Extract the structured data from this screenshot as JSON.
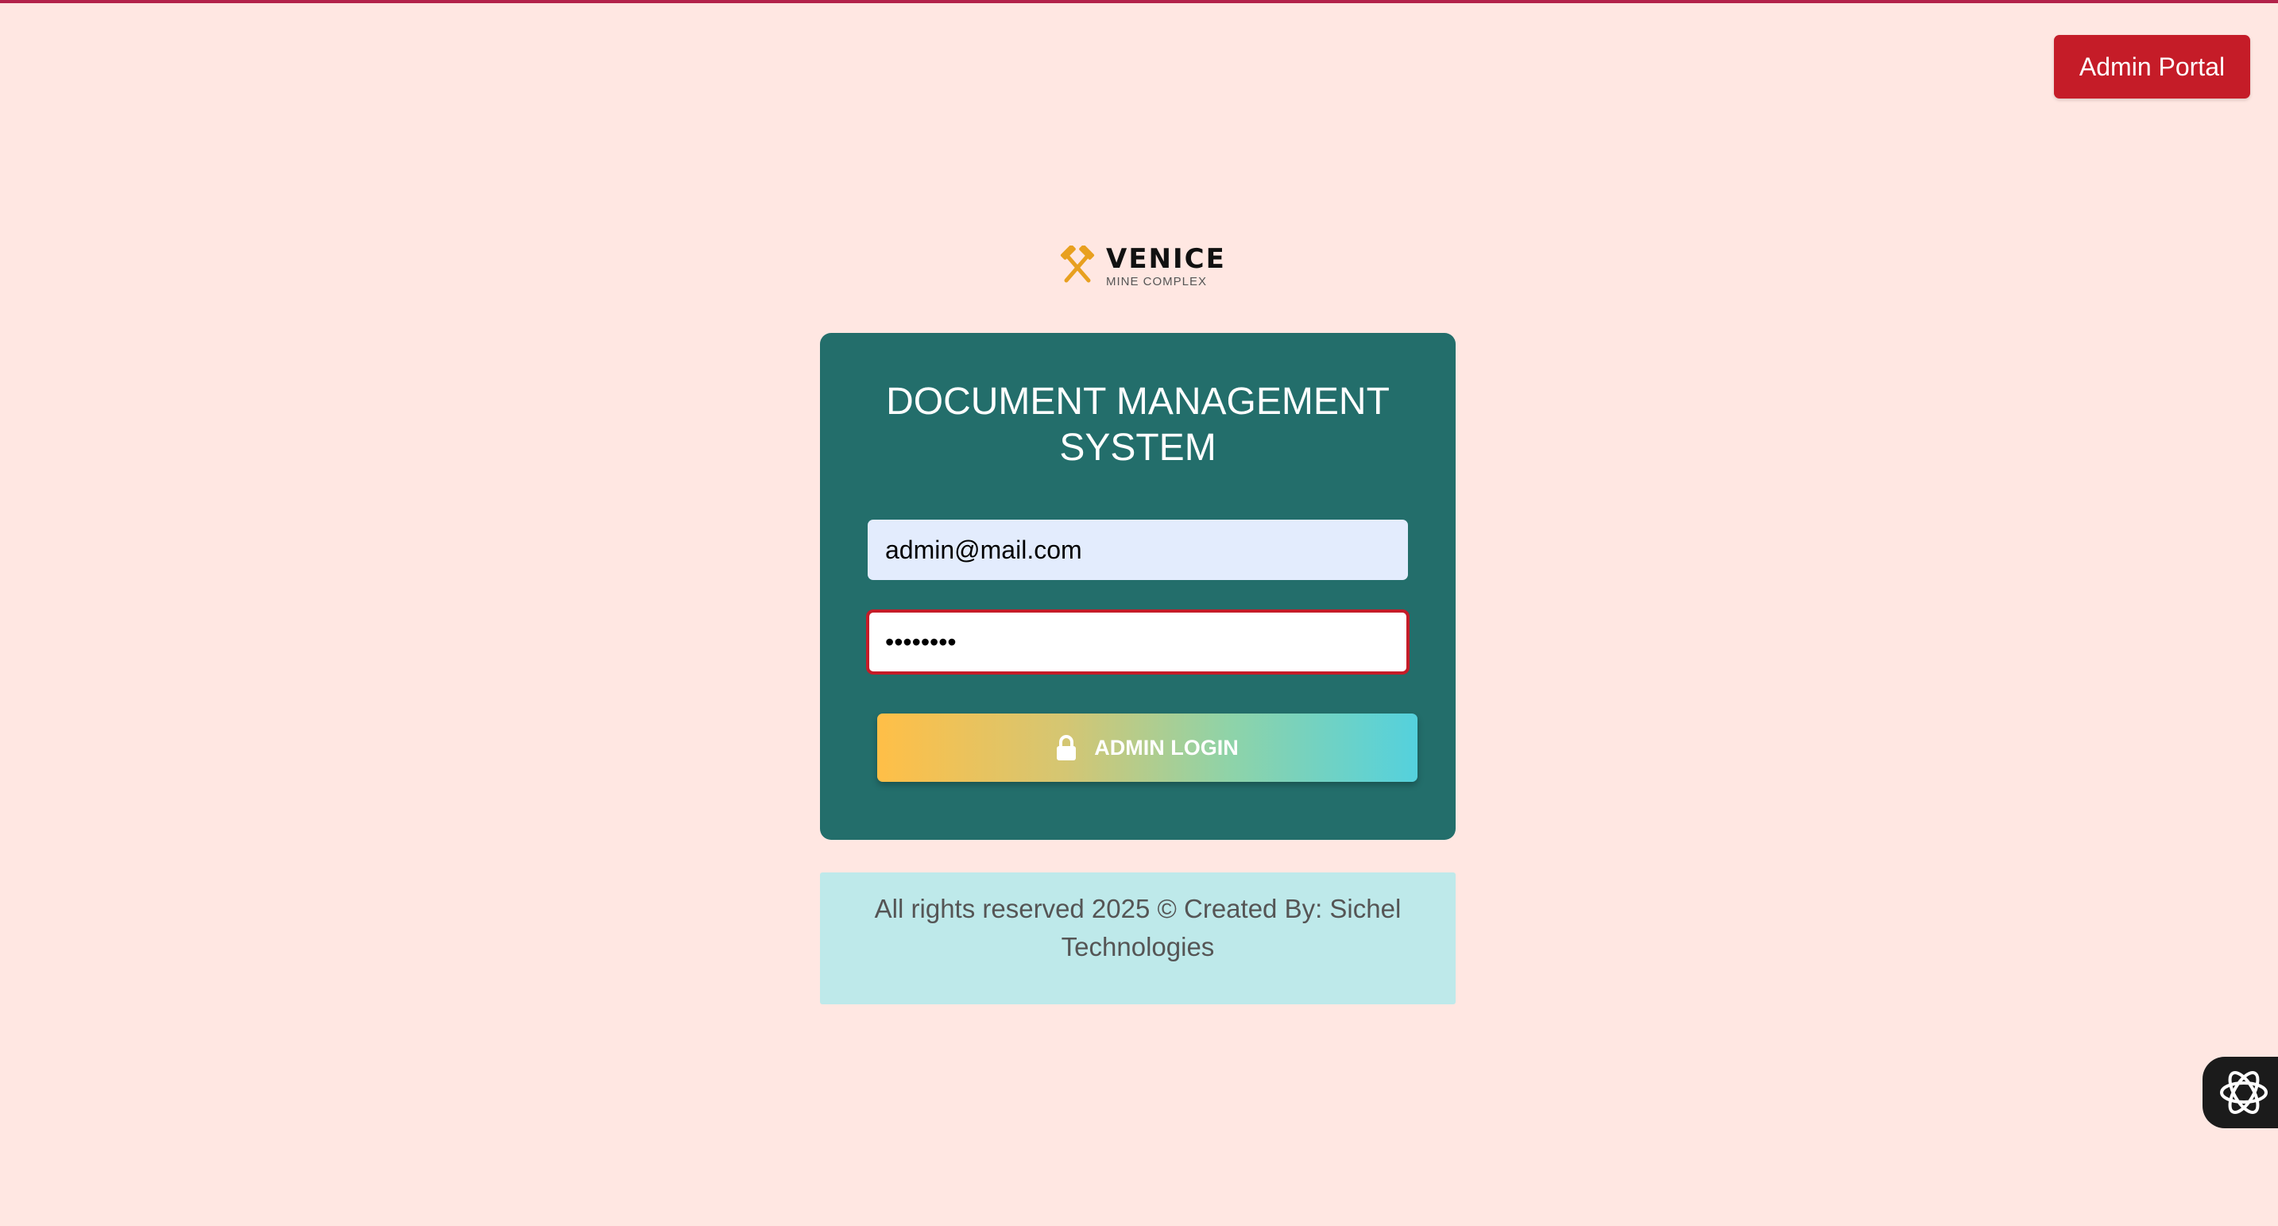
{
  "header": {
    "admin_portal_label": "Admin Portal"
  },
  "logo": {
    "icon": "crossed-hammers-icon",
    "name": "VENICE",
    "subtitle": "MINE COMPLEX",
    "icon_color": "#e8a020"
  },
  "login_card": {
    "title": "DOCUMENT MANAGEMENT SYSTEM",
    "email_value": "admin@mail.com",
    "password_value": "••••••••",
    "login_button_label": "ADMIN LOGIN",
    "login_button_icon": "lock-icon",
    "card_color": "#236e6b"
  },
  "footer": {
    "text": "All rights reserved 2025 © Created By: Sichel Technologies"
  },
  "widget": {
    "icon": "assistant-icon"
  },
  "colors": {
    "background": "#ffe7e2",
    "accent_red": "#c51c28",
    "footer_bg": "#bee9ea"
  }
}
